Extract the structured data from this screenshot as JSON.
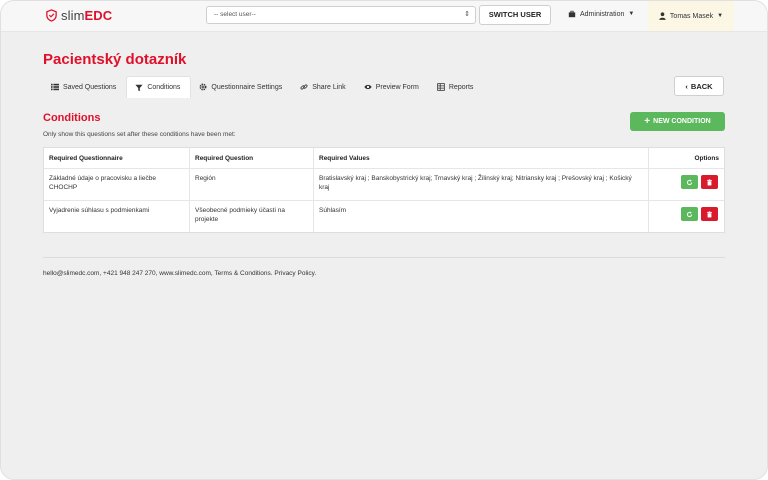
{
  "brand": {
    "prefix": "slim",
    "suffix": "EDC"
  },
  "navbar": {
    "user_select_placeholder": "-- select user--",
    "switch_label": "SWITCH USER",
    "admin_label": "Administration",
    "user_label": "Tomas Masek"
  },
  "page": {
    "title": "Pacientský dotazník"
  },
  "tabs": [
    {
      "label": "Saved Questions",
      "icon": "list-icon"
    },
    {
      "label": "Conditions",
      "icon": "filter-icon"
    },
    {
      "label": "Questionnaire Settings",
      "icon": "gear-icon"
    },
    {
      "label": "Share Link",
      "icon": "link-icon"
    },
    {
      "label": "Preview Form",
      "icon": "eye-icon"
    },
    {
      "label": "Reports",
      "icon": "table-icon"
    }
  ],
  "back_label": "BACK",
  "section": {
    "title": "Conditions",
    "subtitle": "Only show this questions set after these conditions have been met:",
    "new_button": "NEW CONDITION"
  },
  "table": {
    "headers": [
      "Required Questionnaire",
      "Required Question",
      "Required Values",
      "Options"
    ],
    "rows": [
      {
        "questionnaire": "Základné údaje o pracovisku a liečbe CHOCHP",
        "question": "Región",
        "values": "Bratislavský kraj ; Banskobystrický kraj; Trnavský kraj ; Žilinský kraj; Nitriansky kraj ; Prešovský kraj ; Košický kraj"
      },
      {
        "questionnaire": "Vyjadrenie súhlasu s podmienkami",
        "question": "Všeobecné podmieky účasti na projekte",
        "values": "Súhlasím"
      }
    ]
  },
  "footer": {
    "text": "hello@slimedc.com, +421 948 247 270, www.slimedc.com, Terms & Conditions. Privacy Policy."
  },
  "colors": {
    "brand_red": "#e0102b",
    "success_green": "#5cb85c",
    "danger_red": "#d9192c"
  }
}
